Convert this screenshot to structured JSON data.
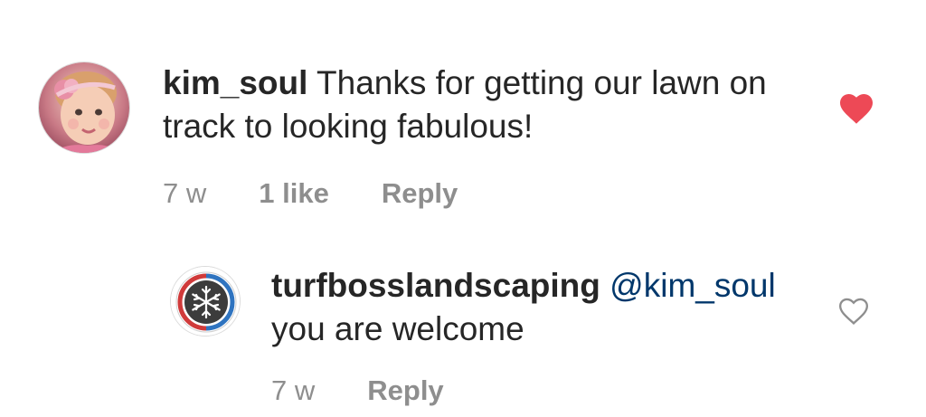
{
  "comments": [
    {
      "username": "kim_soul",
      "text": "Thanks for getting our lawn on track to looking fabulous!",
      "time": "7 w",
      "likes": "1 like",
      "reply_label": "Reply",
      "liked": true,
      "avatar_icon": "baby-photo-avatar"
    }
  ],
  "replies": [
    {
      "username": "turfbosslandscaping",
      "mention": "@kim_soul",
      "text": "you are welcome",
      "time": "7 w",
      "reply_label": "Reply",
      "liked": false,
      "avatar_icon": "snowflake-logo-avatar"
    }
  ],
  "colors": {
    "heart_filled": "#ed4956",
    "meta_text": "#8e8e8e",
    "mention": "#00376b",
    "logo_red": "#d03a3a",
    "logo_blue": "#2f74c0"
  }
}
